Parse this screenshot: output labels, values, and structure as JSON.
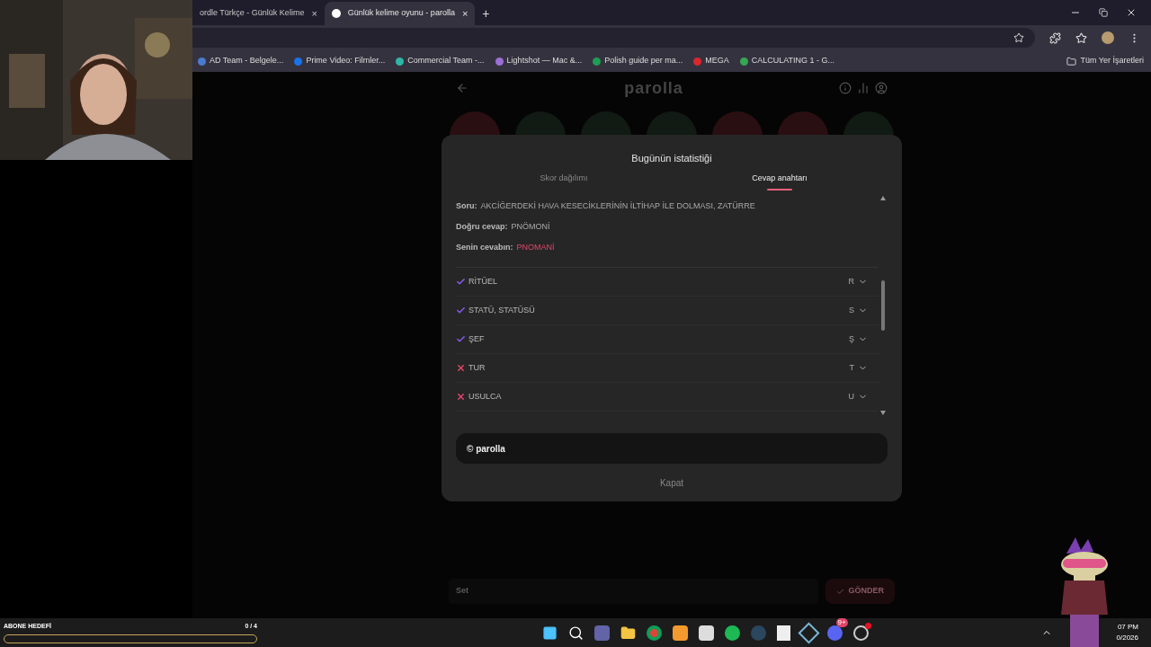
{
  "browser": {
    "tabs": [
      {
        "title": "ordle Türkçe - Günlük Kelime",
        "close": "×",
        "selected": false
      },
      {
        "title": "Günlük kelime oyunu - parolla",
        "close": "×",
        "selected": true
      }
    ],
    "new_tab": "+",
    "bookmarks": [
      {
        "label": "AD Team - Belgele...",
        "color": "#4a7bd0"
      },
      {
        "label": "Prime Video: Filmler...",
        "color": "#1a73e8"
      },
      {
        "label": "Commercial Team -...",
        "color": "#2fb6a8"
      },
      {
        "label": "Lightshot — Mac &...",
        "color": "#9b6fd6"
      },
      {
        "label": "Polish guide per ma...",
        "color": "#1f9d55"
      },
      {
        "label": "MEGA",
        "color": "#d9272e"
      },
      {
        "label": "CALCULATING 1 - G...",
        "color": "#34a853"
      }
    ],
    "all_bookmarks": "Tüm Yer İşaretleri"
  },
  "app": {
    "logo": "parolla",
    "circles": [
      {
        "color": "#2a0f12"
      },
      {
        "color": "#111a13"
      },
      {
        "color": "#111a13"
      },
      {
        "color": "#111a13"
      },
      {
        "color": "#2a0f12"
      },
      {
        "color": "#2a0f12"
      },
      {
        "color": "#111a13"
      }
    ],
    "input_placeholder": "Set",
    "submit": "GÖNDER"
  },
  "modal": {
    "title": "Bugünün istatistiği",
    "tabs": [
      {
        "label": "Skor dağılımı",
        "selected": false
      },
      {
        "label": "Cevap anahtarı",
        "selected": true
      }
    ],
    "details": [
      {
        "label": "Soru:",
        "value": "AKCİĞERDEKİ HAVA KESECİKLERİNİN İLTİHAP İLE DOLMASI, ZATÜRRE",
        "wrong": false
      },
      {
        "label": "Doğru cevap:",
        "value": "PNÖMONİ",
        "wrong": false
      },
      {
        "label": "Senin cevabın:",
        "value": "PNOMANİ",
        "wrong": true
      }
    ],
    "answers": [
      {
        "word": "RİTÜEL",
        "letter": "R",
        "correct": true
      },
      {
        "word": "STATÜ, STATÜSÜ",
        "letter": "S",
        "correct": true
      },
      {
        "word": "ŞEF",
        "letter": "Ş",
        "correct": true
      },
      {
        "word": "TUR",
        "letter": "T",
        "correct": false
      },
      {
        "word": "USULCA",
        "letter": "U",
        "correct": false
      }
    ],
    "footer": "© parolla",
    "close": "Kapat"
  },
  "overlay": {
    "goal_label": "ABONE HEDEFİ",
    "goal_count": "0 / 4",
    "level": 0
  },
  "taskbar": {
    "discord_badge": "9+",
    "time": "07 PM",
    "date": "0/2026"
  }
}
